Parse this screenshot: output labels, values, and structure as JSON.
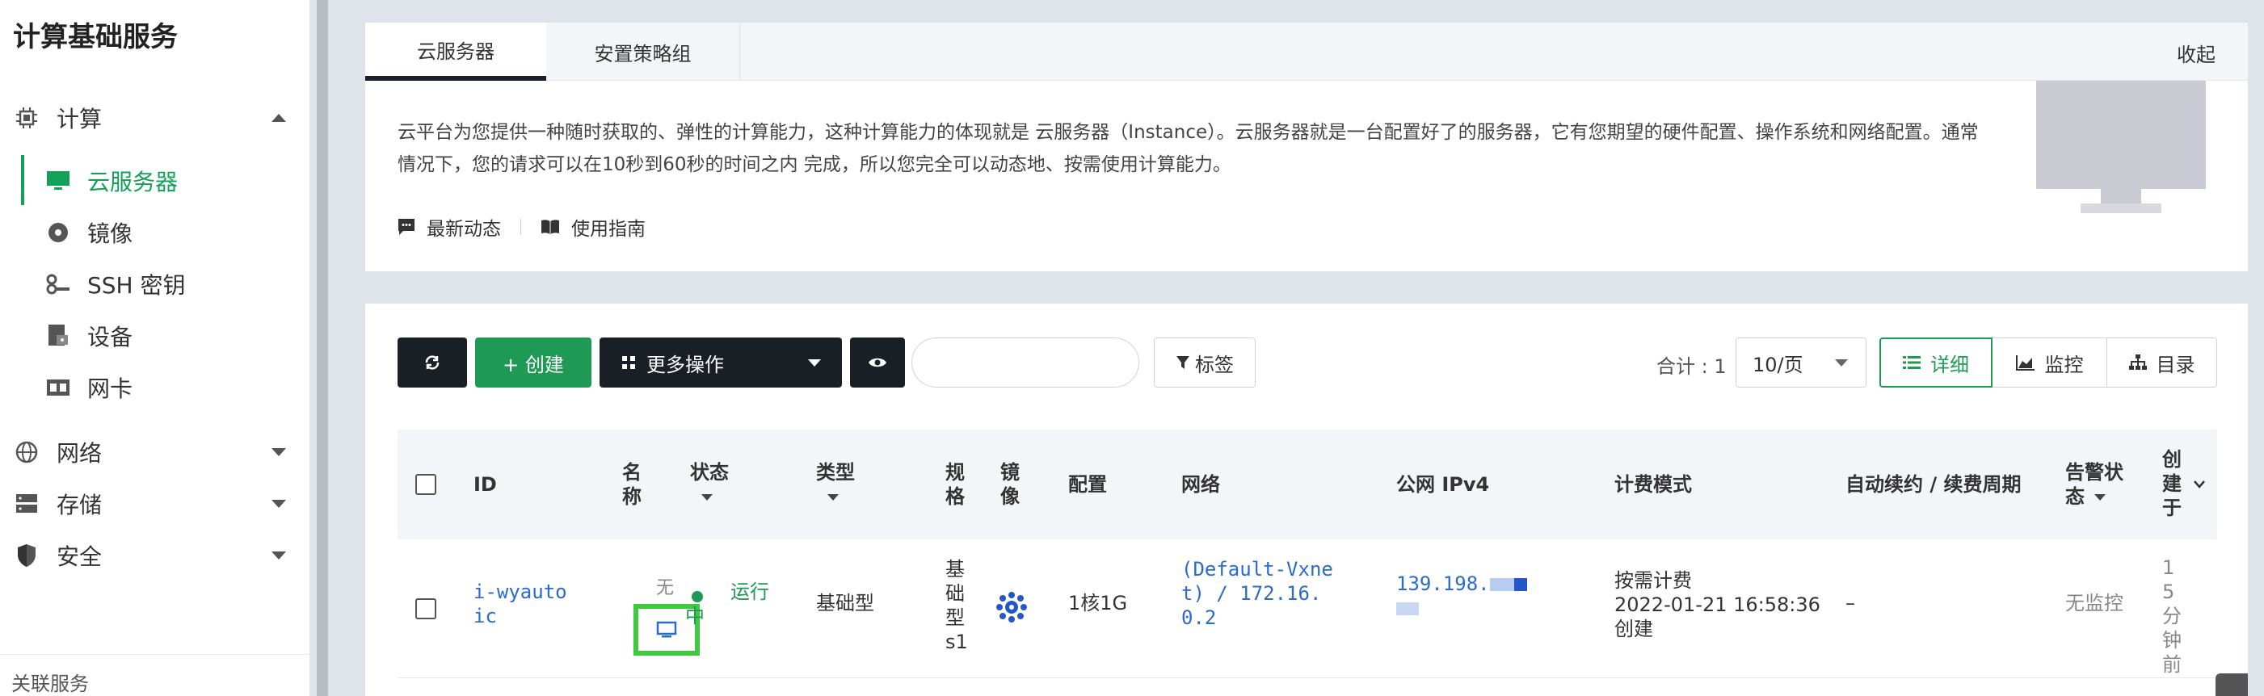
{
  "sidebar": {
    "title": "计算基础服务",
    "groups": [
      {
        "label": "计算"
      },
      {
        "label": "网络"
      },
      {
        "label": "存储"
      },
      {
        "label": "安全"
      }
    ],
    "compute_items": [
      {
        "label": "云服务器"
      },
      {
        "label": "镜像"
      },
      {
        "label": "SSH 密钥"
      },
      {
        "label": "设备"
      },
      {
        "label": "网卡"
      }
    ],
    "footer": "关联服务"
  },
  "intro": {
    "tabs": [
      "云服务器",
      "安置策略组"
    ],
    "collapse": "收起",
    "description": "云平台为您提供一种随时获取的、弹性的计算能力，这种计算能力的体现就是 云服务器（Instance）。云服务器就是一台配置好了的服务器，它有您期望的硬件配置、操作系统和网络配置。通常情况下，您的请求可以在10秒到60秒的时间之内 完成，所以您完全可以动态地、按需使用计算能力。",
    "links": [
      "最新动态",
      "使用指南"
    ]
  },
  "toolbar": {
    "create": "+ 创建",
    "more": "更多操作",
    "tag": "标签",
    "total": "合计 : 1",
    "page_size": "10/页",
    "views": [
      "详细",
      "监控",
      "目录"
    ]
  },
  "table": {
    "headers": {
      "id": "ID",
      "name": "名称",
      "status": "状态",
      "type": "类型",
      "spec": "规格",
      "image": "镜像",
      "config": "配置",
      "network": "网络",
      "ipv4": "公网 IPv4",
      "billing": "计费模式",
      "renew": "自动续约 / 续费周期",
      "alarm": "告警状态",
      "created": "创建于"
    },
    "rows": [
      {
        "id": "i-wyautoic",
        "name": "无",
        "status": "运行中",
        "type": "基础型",
        "spec": "基础型s1",
        "config": "1核1G",
        "network": "(Default-Vxnet) / 172.16.0.2",
        "ipv4": "139.198.",
        "billing_mode": "按需计费",
        "billing_time": "2022-01-21 16:58:36",
        "billing_suffix": "创建",
        "renew": "–",
        "alarm": "无监控",
        "created": "15分钟前"
      }
    ]
  },
  "colors": {
    "accent": "#1e9a55",
    "dark_button": "#1a1f26",
    "link": "#2a6bd1",
    "highlight_box": "#3ec93e"
  }
}
